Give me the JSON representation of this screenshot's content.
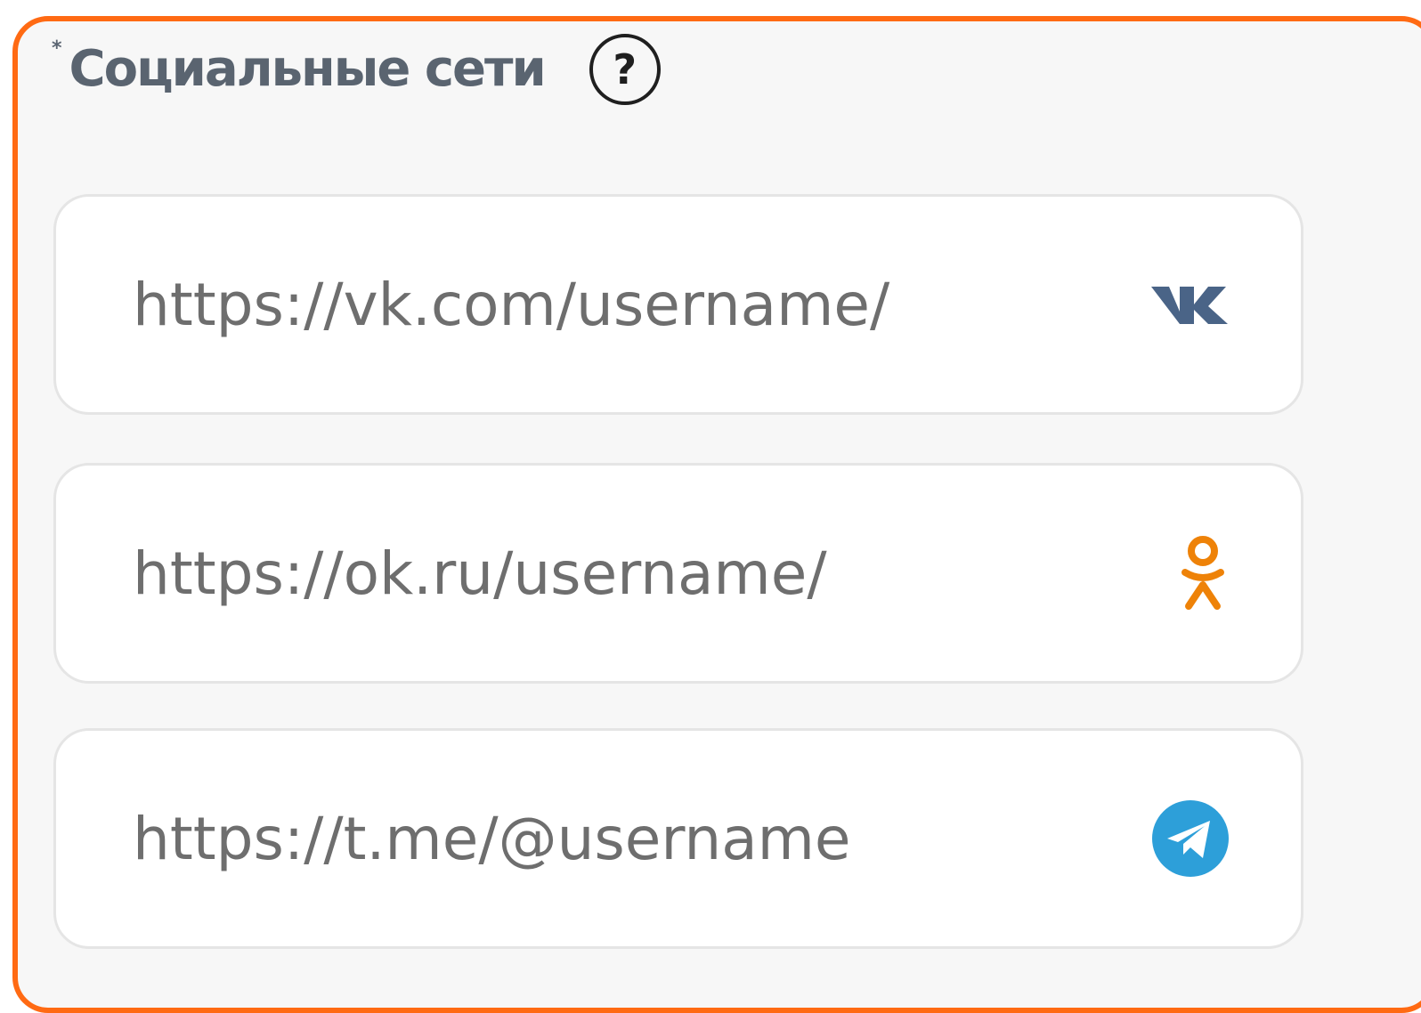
{
  "section": {
    "required_mark": "*",
    "title": "Социальные сети",
    "help_label": "?"
  },
  "fields": [
    {
      "name": "vk",
      "placeholder": "https://vk.com/username/",
      "icon": "vk-icon",
      "icon_color": "#4a6487"
    },
    {
      "name": "ok",
      "placeholder": "https://ok.ru/username/",
      "icon": "odnoklassniki-icon",
      "icon_color": "#ee8208"
    },
    {
      "name": "telegram",
      "placeholder": "https://t.me/@username",
      "icon": "telegram-icon",
      "icon_color": "#2d9fd9"
    }
  ],
  "colors": {
    "frame_border": "#ff6a13",
    "background": "#f7f7f7",
    "field_background": "#ffffff",
    "text": "#6e6e6e"
  }
}
